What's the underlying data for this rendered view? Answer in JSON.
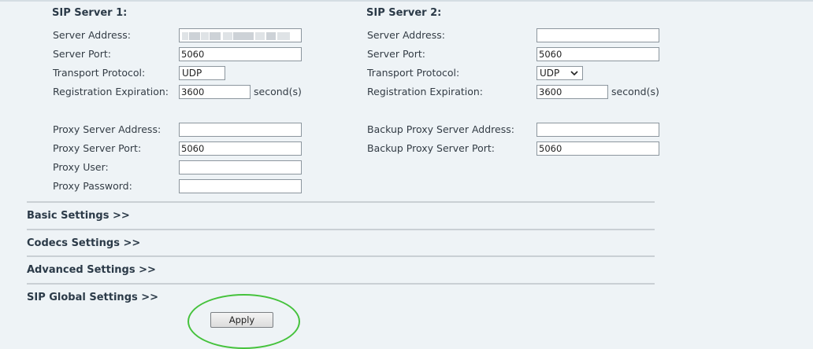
{
  "sip1": {
    "title": "SIP Server 1:",
    "server_address_label": "Server Address:",
    "server_address_value": "",
    "server_port_label": "Server Port:",
    "server_port_value": "5060",
    "transport_label": "Transport Protocol:",
    "transport_value": "UDP",
    "reg_exp_label": "Registration Expiration:",
    "reg_exp_value": "3600",
    "reg_exp_unit": "second(s)",
    "proxy_address_label": "Proxy Server Address:",
    "proxy_address_value": "",
    "proxy_port_label": "Proxy Server Port:",
    "proxy_port_value": "5060",
    "proxy_user_label": "Proxy User:",
    "proxy_user_value": "",
    "proxy_password_label": "Proxy Password:",
    "proxy_password_value": ""
  },
  "sip2": {
    "title": "SIP Server 2:",
    "server_address_label": "Server Address:",
    "server_address_value": "",
    "server_port_label": "Server Port:",
    "server_port_value": "5060",
    "transport_label": "Transport Protocol:",
    "transport_value": "UDP",
    "reg_exp_label": "Registration Expiration:",
    "reg_exp_value": "3600",
    "reg_exp_unit": "second(s)",
    "backup_proxy_address_label": "Backup Proxy Server Address:",
    "backup_proxy_address_value": "",
    "backup_proxy_port_label": "Backup Proxy Server Port:",
    "backup_proxy_port_value": "5060"
  },
  "sections": {
    "basic": "Basic Settings >>",
    "codecs": "Codecs Settings >>",
    "advanced": "Advanced Settings >>",
    "sip_global": "SIP Global Settings >>"
  },
  "apply_label": "Apply",
  "colors": {
    "background": "#eef3f6",
    "highlight_circle": "#45c23c",
    "divider": "#c9cfd4"
  },
  "icons": {
    "select_arrow": "chevron-down-icon"
  }
}
